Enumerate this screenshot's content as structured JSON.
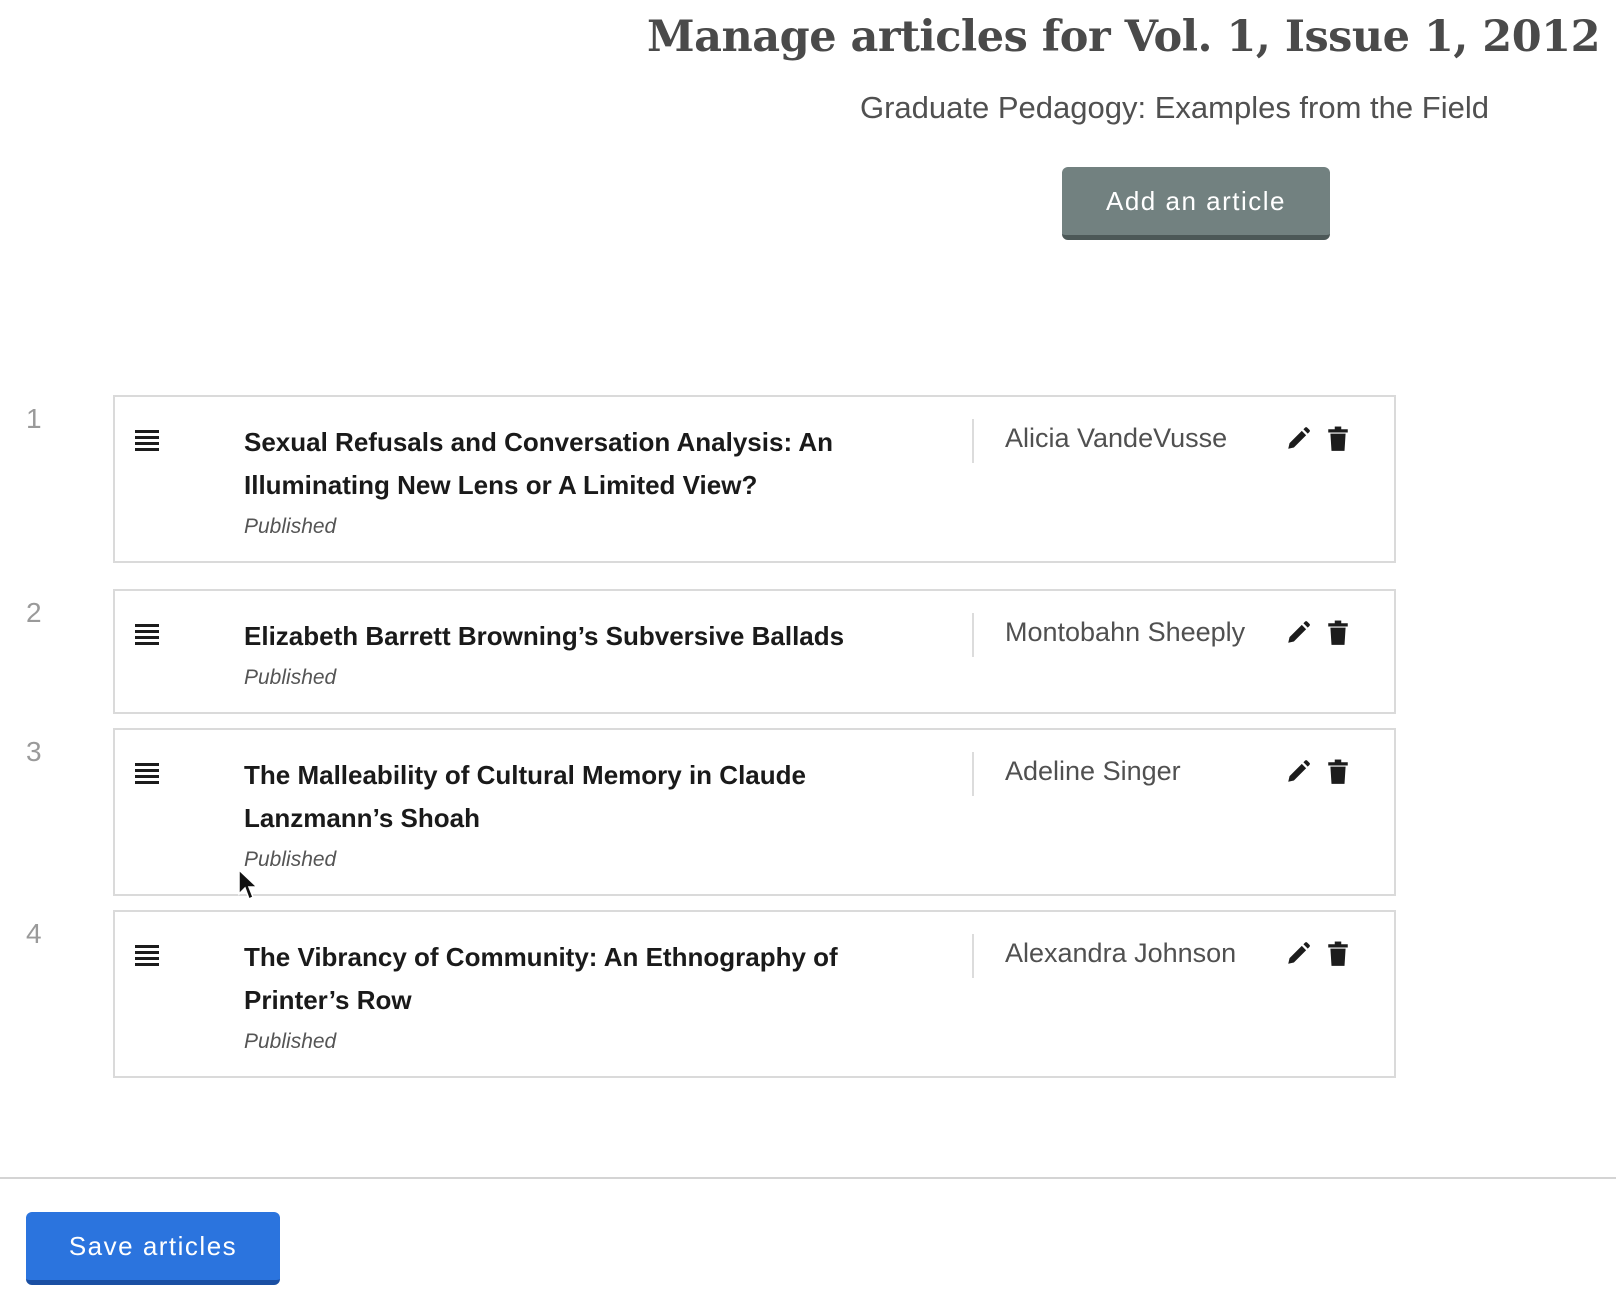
{
  "header": {
    "title": "Manage articles for Vol. 1, Issue 1, 2012",
    "subtitle": "Graduate Pedagogy: Examples from the Field",
    "add_button_label": "Add an article"
  },
  "articles": [
    {
      "number": "1",
      "title": "Sexual Refusals and Conversation Analysis: An Illuminating New Lens or A Limited View?",
      "status": "Published",
      "author": "Alicia VandeVusse"
    },
    {
      "number": "2",
      "title": "Elizabeth Barrett Browning’s Subversive Ballads",
      "status": "Published",
      "author": "Montobahn Sheeply"
    },
    {
      "number": "3",
      "title": "The Malleability of Cultural Memory in Claude Lanzmann’s Shoah",
      "status": "Published",
      "author": "Adeline Singer"
    },
    {
      "number": "4",
      "title": "The Vibrancy of Community: An Ethnography of Printer’s Row",
      "status": "Published",
      "author": "Alexandra Johnson"
    }
  ],
  "icons": {
    "drag": "drag-handle-icon",
    "edit": "pencil-icon",
    "delete": "trash-icon"
  },
  "footer": {
    "save_button_label": "Save articles"
  },
  "colors": {
    "add_button": "#728180",
    "save_button": "#2b74de"
  }
}
